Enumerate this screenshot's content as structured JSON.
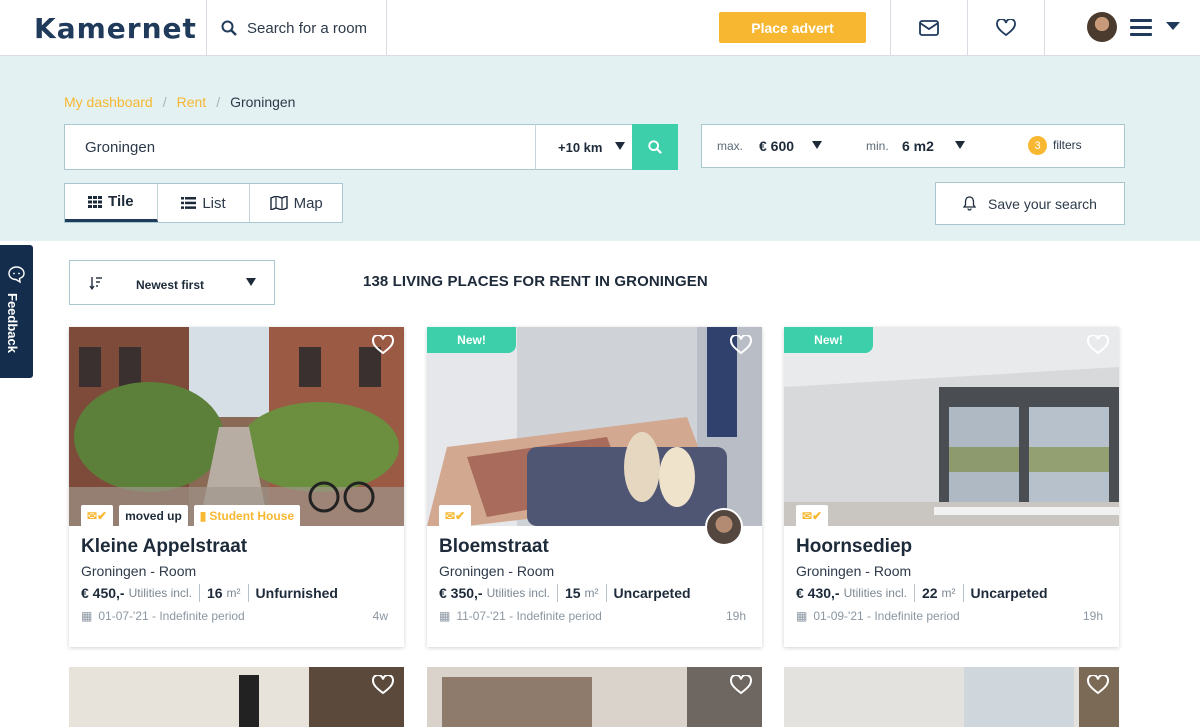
{
  "header": {
    "logo": "Kamernet",
    "search_placeholder": "Search for a room",
    "place_advert": "Place advert"
  },
  "breadcrumb": [
    "My dashboard",
    "Rent",
    "Groningen"
  ],
  "search": {
    "location": "Groningen",
    "radius": "+10 km",
    "max_label": "max.",
    "max_value": "€ 600",
    "min_label": "min.",
    "min_value": "6 m2",
    "filters_count": "3",
    "filters_label": "filters"
  },
  "views": {
    "tile": "Tile",
    "list": "List",
    "map": "Map",
    "active": "Tile"
  },
  "save_search": "Save your search",
  "feedback": "Feedback",
  "sort": "Newest first",
  "results_heading": "138 LIVING PLACES FOR RENT IN GRONINGEN",
  "listings": [
    {
      "new": "",
      "tags": [
        "moved up",
        "Student House"
      ],
      "title": "Kleine Appelstraat",
      "subtitle": "Groningen - Room",
      "price": "€ 450,-",
      "utilities": "Utilities incl.",
      "size": "16",
      "unit": "m²",
      "furnishing": "Unfurnished",
      "date": "01-07-'21 - Indefinite period",
      "age": "4w"
    },
    {
      "new": "New!",
      "tags": [],
      "title": "Bloemstraat",
      "subtitle": "Groningen - Room",
      "price": "€ 350,-",
      "utilities": "Utilities incl.",
      "size": "15",
      "unit": "m²",
      "furnishing": "Uncarpeted",
      "date": "11-07-'21 - Indefinite period",
      "age": "19h"
    },
    {
      "new": "New!",
      "tags": [],
      "title": "Hoornsediep",
      "subtitle": "Groningen - Room",
      "price": "€ 430,-",
      "utilities": "Utilities incl.",
      "size": "22",
      "unit": "m²",
      "furnishing": "Uncarpeted",
      "date": "01-09-'21 - Indefinite period",
      "age": "19h"
    }
  ],
  "colors": {
    "accent": "#f7b731",
    "teal": "#3ccfaa",
    "navy": "#1f3a5a",
    "hero_bg": "#e3f1f2"
  }
}
